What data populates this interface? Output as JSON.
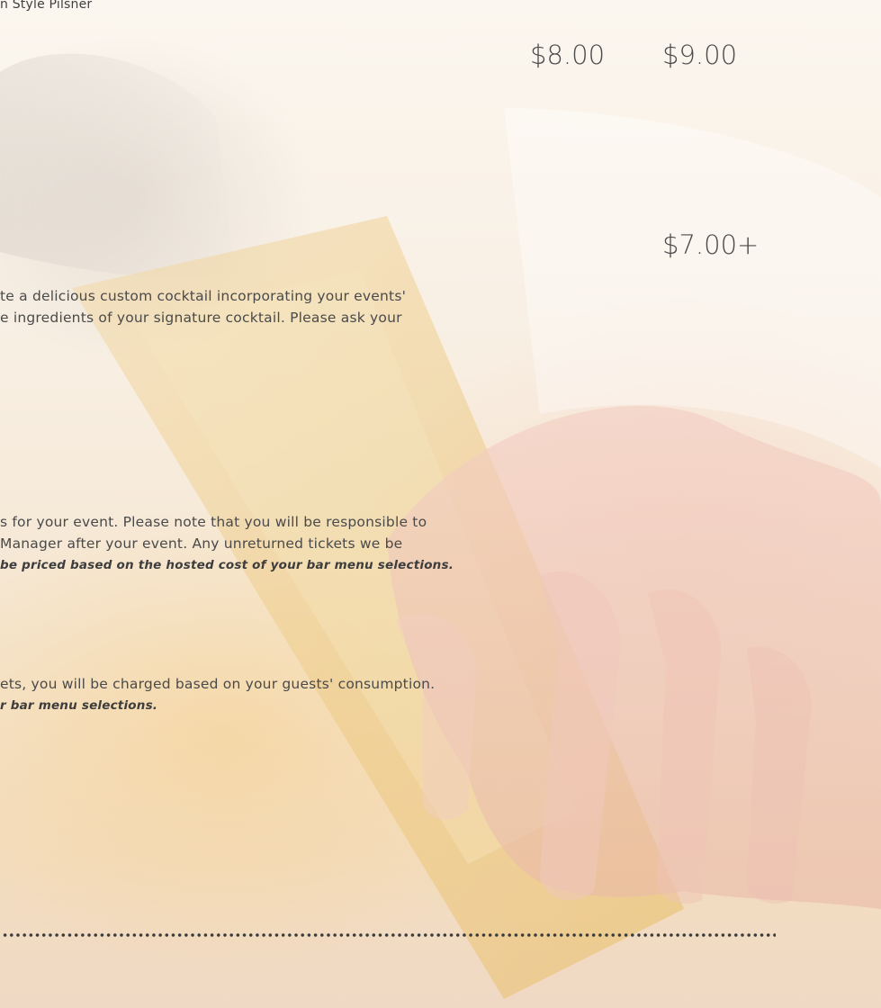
{
  "beer_style_line": "n Style Pilsner",
  "prices": {
    "price_1": "$8.00",
    "price_2": "$9.00",
    "cocktail_price": "$7.00+"
  },
  "signature_cocktail": {
    "line_1": "te a delicious custom cocktail incorporating your events'",
    "line_2": "e ingredients of your signature cocktail. Please ask your"
  },
  "drink_tickets": {
    "line_1": "s for your event. Please note that you will be responsible to",
    "line_2": "Manager after your event. Any unreturned tickets we be",
    "line_3_emphasis": "be priced based on the hosted cost of your bar menu selections."
  },
  "consumption_bar": {
    "line_1": "ets, you will be charged based on your guests' consumption.",
    "line_2_emphasis": "r bar menu selections."
  },
  "colors": {
    "text": "#4a4a4a",
    "dots": "#3b3b3b",
    "background_warm": "#f5e5cf"
  }
}
